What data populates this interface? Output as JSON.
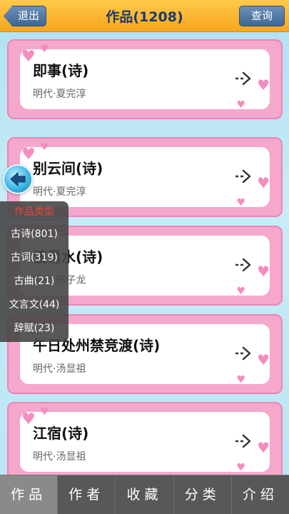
{
  "header": {
    "back_label": "退出",
    "title": "作品(1208)",
    "query_label": "查询"
  },
  "works": [
    {
      "title": "即事(诗)",
      "author": "明代·夏完淳"
    },
    {
      "title": "别云间(诗)",
      "author": "明代·夏完淳"
    },
    {
      "title": "渡易水(诗)",
      "author": "明代·陈子龙"
    },
    {
      "title": "午日处州禁竞渡(诗)",
      "author": "明代·汤显祖"
    },
    {
      "title": "江宿(诗)",
      "author": "明代·汤显祖"
    }
  ],
  "category_panel": {
    "header": "作品类型",
    "items": [
      "古诗(801)",
      "古词(319)",
      "古曲(21)",
      "文言文(44)",
      "辞赋(23)"
    ]
  },
  "tabs": [
    "作品",
    "作者",
    "收藏",
    "分类",
    "介绍"
  ],
  "active_tab": 0,
  "colors": {
    "header_orange": "#f7a51c",
    "card_pink": "#f5a8cc",
    "category_header_red": "#e8473a",
    "tabbar_gray": "#585858"
  }
}
